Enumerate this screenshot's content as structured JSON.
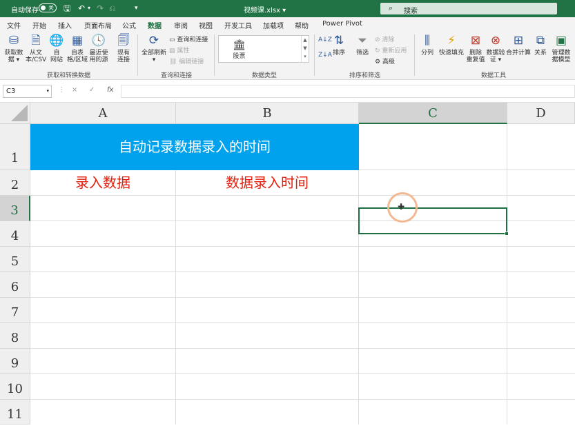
{
  "titlebar": {
    "autosave_label": "自动保存",
    "autosave_state": "关",
    "save_icon": "save-icon",
    "undo_icon": "undo-icon",
    "redo_icon": "redo-icon",
    "doc_title": "视频课.xlsx ▾",
    "search_placeholder": "搜索",
    "bg_color": "#217346"
  },
  "menu": {
    "items": [
      "文件",
      "开始",
      "插入",
      "页面布局",
      "公式",
      "数据",
      "审阅",
      "视图",
      "开发工具",
      "加载项",
      "帮助",
      "Power Pivot"
    ],
    "active": "数据"
  },
  "ribbon": {
    "get_data": "获取数\n据 ▾",
    "from_csv": "从文\n本/CSV",
    "from_web": "自\n网站",
    "from_table": "自表\n格/区域",
    "recent_sources": "最近使\n用的源",
    "existing_conn": "现有\n连接",
    "group1_label": "获取和转换数据",
    "refresh_all": "全部刷新",
    "queries_conn": "查询和连接",
    "properties": "属性",
    "edit_links": "编辑链接",
    "group2_label": "查询和连接",
    "stock": "股票",
    "group3_label": "数据类型",
    "sort_az": "A↓Z",
    "sort_za": "Z↓A",
    "sort": "排序",
    "filter": "筛选",
    "clear": "清除",
    "reapply": "重新应用",
    "advanced": "高级",
    "group4_label": "排序和筛选",
    "text_to_cols": "分列",
    "flash_fill": "快速填充",
    "remove_dup": "删除\n重复值",
    "data_validation": "数据验\n证 ▾",
    "consolidate": "合并计算",
    "relationships": "关系",
    "data_model": "管理数\n据模型",
    "group5_label": "数据工具"
  },
  "formula_bar": {
    "name_box": "C3",
    "cancel_icon": "×",
    "enter_icon": "✓",
    "fx_icon": "fx",
    "formula": ""
  },
  "sheet": {
    "columns": [
      "A",
      "B",
      "C",
      "D"
    ],
    "rows": [
      "1",
      "2",
      "3",
      "4",
      "5",
      "6",
      "7",
      "8",
      "9",
      "10",
      "11"
    ],
    "selected_cell": "C3",
    "title": "自动记录数据录入的时间",
    "header_a2": "录入数据",
    "header_b2": "数据录入时间",
    "title_color": "#00a2ed",
    "header_color": "#e02010"
  }
}
